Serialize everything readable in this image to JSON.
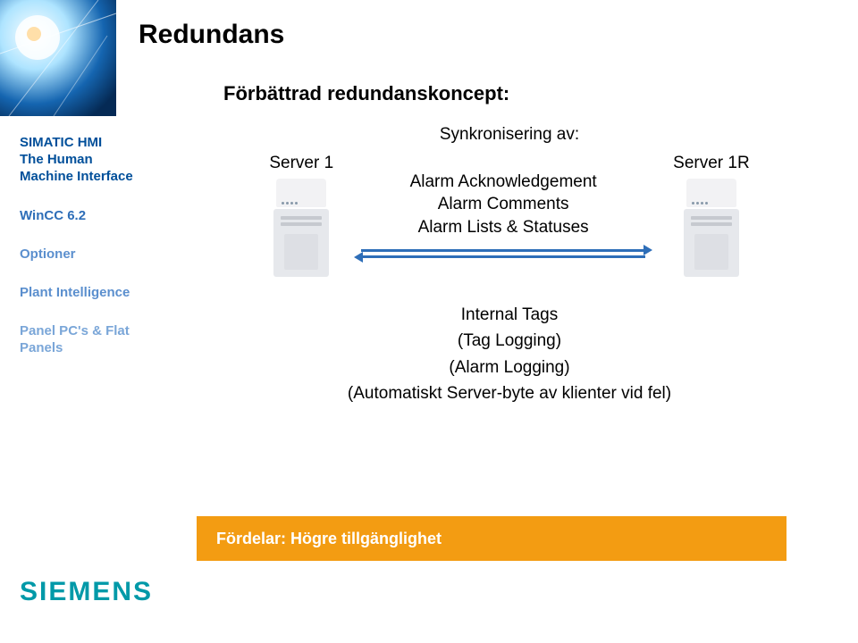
{
  "title": "Redundans",
  "subtitle": "Förbättrad redundanskoncept:",
  "sidebar": {
    "items": [
      {
        "label": "SIMATIC HMI\nThe Human\nMachine Interface"
      },
      {
        "label": "WinCC 6.2"
      },
      {
        "label": "Optioner"
      },
      {
        "label": "Plant Intelligence"
      },
      {
        "label": "Panel PC's & Flat Panels"
      }
    ]
  },
  "sync": {
    "heading": "Synkronisering av:",
    "server_left_label": "Server 1",
    "server_right_label": "Server 1R",
    "alarm_ack": "Alarm Acknowledgement",
    "alarm_comments": "Alarm Comments",
    "alarm_lists": "Alarm Lists & Statuses",
    "internal_tags": "Internal Tags",
    "tag_logging": "(Tag Logging)",
    "alarm_logging": "(Alarm Logging)",
    "auto_switch": "(Automatiskt Server-byte av klienter vid fel)"
  },
  "footer": {
    "text": "Fördelar: Högre tillgänglighet"
  },
  "brand": "SIEMENS"
}
